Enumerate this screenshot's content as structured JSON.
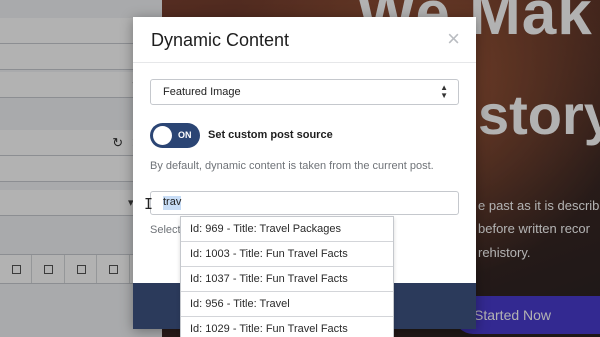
{
  "background": {
    "hero": {
      "title": "We Mak",
      "headline": "story",
      "paragraph_lines": [
        "e past as it is describ",
        "before written recor",
        "rehistory."
      ],
      "cta_label": "Started Now"
    }
  },
  "editor_panel": {
    "row_icons": [
      "refresh-icon",
      "close-icon"
    ],
    "align_buttons": [
      "align-left",
      "align-center",
      "align-right",
      "align-justify",
      "align-none"
    ]
  },
  "modal": {
    "title": "Dynamic Content",
    "close_glyph": "×",
    "field_select": {
      "value": "Featured Image",
      "arrows": "▲▼"
    },
    "custom_source_toggle": {
      "state": "ON",
      "label": "Set custom post source"
    },
    "help_text": "By default, dynamic content is taken from the current post.",
    "search": {
      "value": "trav"
    },
    "select_hint": "Select",
    "suggestions": [
      "Id: 969 - Title: Travel Packages",
      "Id: 1003 - Title: Fun Travel Facts",
      "Id: 1037 - Title: Fun Travel Facts",
      "Id: 956 - Title: Travel",
      "Id: 1029 - Title: Fun Travel Facts"
    ]
  },
  "colors": {
    "toggle_on": "#2b4574",
    "footer": "#2b3a5b",
    "cta": "#4a3bd0"
  }
}
